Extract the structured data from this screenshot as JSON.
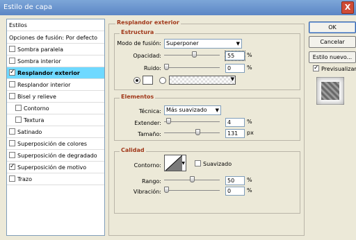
{
  "window": {
    "title": "Estilo de capa",
    "close_glyph": "X"
  },
  "left_list": {
    "header": "Estilos",
    "items": [
      {
        "label": "Opciones de fusión: Por defecto",
        "checkbox": false,
        "checked": false,
        "indent": false,
        "selected": false
      },
      {
        "label": "Sombra paralela",
        "checkbox": true,
        "checked": false,
        "indent": false,
        "selected": false
      },
      {
        "label": "Sombra interior",
        "checkbox": true,
        "checked": false,
        "indent": false,
        "selected": false
      },
      {
        "label": "Resplandor exterior",
        "checkbox": true,
        "checked": true,
        "indent": false,
        "selected": true
      },
      {
        "label": "Resplandor interior",
        "checkbox": true,
        "checked": false,
        "indent": false,
        "selected": false
      },
      {
        "label": "Bisel y relieve",
        "checkbox": true,
        "checked": false,
        "indent": false,
        "selected": false
      },
      {
        "label": "Contorno",
        "checkbox": true,
        "checked": false,
        "indent": true,
        "selected": false
      },
      {
        "label": "Textura",
        "checkbox": true,
        "checked": false,
        "indent": true,
        "selected": false
      },
      {
        "label": "Satinado",
        "checkbox": true,
        "checked": false,
        "indent": false,
        "selected": false
      },
      {
        "label": "Superposición de colores",
        "checkbox": true,
        "checked": false,
        "indent": false,
        "selected": false
      },
      {
        "label": "Superposición de degradado",
        "checkbox": true,
        "checked": false,
        "indent": false,
        "selected": false
      },
      {
        "label": "Superposición de motivo",
        "checkbox": true,
        "checked": true,
        "indent": false,
        "selected": false
      },
      {
        "label": "Trazo",
        "checkbox": true,
        "checked": false,
        "indent": false,
        "selected": false
      }
    ]
  },
  "panel": {
    "title": "Resplandor exterior",
    "structure": {
      "title": "Estructura",
      "blend_mode_label": "Modo de fusión:",
      "blend_mode_value": "Superponer",
      "opacity_label": "Opacidad:",
      "opacity_value": "55",
      "opacity_percent": 55,
      "noise_label": "Ruido:",
      "noise_value": "0",
      "noise_percent": 0,
      "unit_percent": "%"
    },
    "elements": {
      "title": "Elementos",
      "technique_label": "Técnica:",
      "technique_value": "Más suavizado",
      "spread_label": "Extender:",
      "spread_value": "4",
      "spread_percent": 4,
      "size_label": "Tamaño:",
      "size_value": "131",
      "size_unit": "px",
      "unit_percent": "%"
    },
    "quality": {
      "title": "Calidad",
      "contour_label": "Contorno:",
      "antialias_label": "Suavizado",
      "antialias_checked": false,
      "range_label": "Rango:",
      "range_value": "50",
      "range_percent": 50,
      "jitter_label": "Vibración:",
      "jitter_value": "0",
      "jitter_percent": 0,
      "unit_percent": "%"
    }
  },
  "buttons": {
    "ok": "OK",
    "cancel": "Cancelar",
    "new_style": "Estilo nuevo...",
    "preview_label": "Previsualizar",
    "preview_checked": true
  },
  "colors": {
    "title_accent": "#a0381a",
    "selection": "#6fd9ff",
    "glow_color_swatch": "#ffffff"
  }
}
